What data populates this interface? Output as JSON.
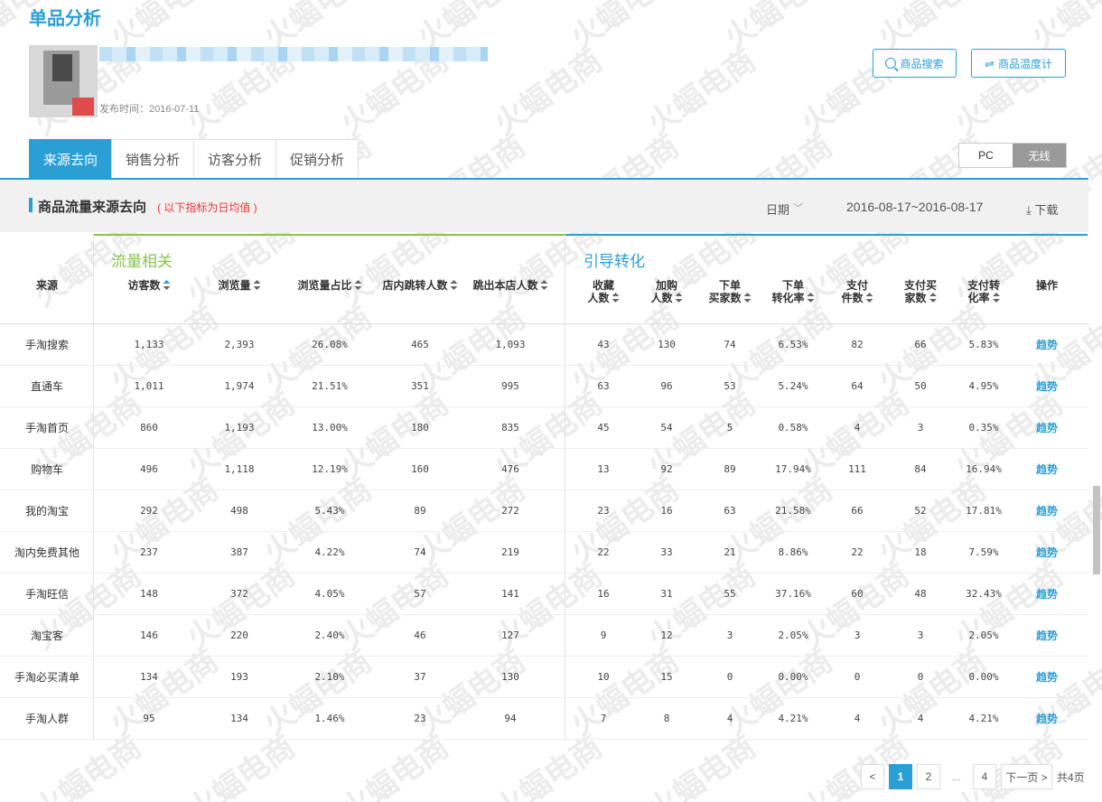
{
  "page": {
    "title": "单品分析",
    "publish_time": "发布时间：2016-07-11",
    "search_button": "商品搜索",
    "thermometer_button": "商品温度计"
  },
  "tabs": [
    "来源去向",
    "销售分析",
    "访客分析",
    "促销分析"
  ],
  "device_toggle": {
    "pc": "PC",
    "wireless": "无线",
    "selected": "无线"
  },
  "section": {
    "title": "商品流量来源去向",
    "note": "( 以下指标为日均值 )",
    "date_label": "日期",
    "date_range": "2016-08-17~2016-08-17",
    "download": "下载"
  },
  "groups": {
    "traffic": "流量相关",
    "conversion": "引导转化"
  },
  "columns": [
    {
      "label": "来源",
      "sortable": false
    },
    {
      "label": "访客数",
      "sortable": true
    },
    {
      "label": "浏览量",
      "sortable": true
    },
    {
      "label": "浏览量占比",
      "sortable": true
    },
    {
      "label": "店内跳转人数",
      "sortable": true
    },
    {
      "label": "跳出本店人数",
      "sortable": true
    },
    {
      "label": "收藏人数",
      "sortable": true
    },
    {
      "label": "加购人数",
      "sortable": true
    },
    {
      "label": "下单买家数",
      "sortable": true
    },
    {
      "label": "下单转化率",
      "sortable": true
    },
    {
      "label": "支付件数",
      "sortable": true
    },
    {
      "label": "支付买家数",
      "sortable": true
    },
    {
      "label": "支付转化率",
      "sortable": true
    },
    {
      "label": "操作",
      "sortable": false
    }
  ],
  "rows": [
    [
      "手淘搜索",
      "1,133",
      "2,393",
      "26.08%",
      "465",
      "1,093",
      "43",
      "130",
      "74",
      "6.53%",
      "82",
      "66",
      "5.83%",
      "趋势"
    ],
    [
      "直通车",
      "1,011",
      "1,974",
      "21.51%",
      "351",
      "995",
      "63",
      "96",
      "53",
      "5.24%",
      "64",
      "50",
      "4.95%",
      "趋势"
    ],
    [
      "手淘首页",
      "860",
      "1,193",
      "13.00%",
      "180",
      "835",
      "45",
      "54",
      "5",
      "0.58%",
      "4",
      "3",
      "0.35%",
      "趋势"
    ],
    [
      "购物车",
      "496",
      "1,118",
      "12.19%",
      "160",
      "476",
      "13",
      "92",
      "89",
      "17.94%",
      "111",
      "84",
      "16.94%",
      "趋势"
    ],
    [
      "我的淘宝",
      "292",
      "498",
      "5.43%",
      "89",
      "272",
      "23",
      "16",
      "63",
      "21.58%",
      "66",
      "52",
      "17.81%",
      "趋势"
    ],
    [
      "淘内免费其他",
      "237",
      "387",
      "4.22%",
      "74",
      "219",
      "22",
      "33",
      "21",
      "8.86%",
      "22",
      "18",
      "7.59%",
      "趋势"
    ],
    [
      "手淘旺信",
      "148",
      "372",
      "4.05%",
      "57",
      "141",
      "16",
      "31",
      "55",
      "37.16%",
      "60",
      "48",
      "32.43%",
      "趋势"
    ],
    [
      "淘宝客",
      "146",
      "220",
      "2.40%",
      "46",
      "127",
      "9",
      "12",
      "3",
      "2.05%",
      "3",
      "3",
      "2.05%",
      "趋势"
    ],
    [
      "手淘必买清单",
      "134",
      "193",
      "2.10%",
      "37",
      "130",
      "10",
      "15",
      "0",
      "0.00%",
      "0",
      "0",
      "0.00%",
      "趋势"
    ],
    [
      "手淘人群",
      "95",
      "134",
      "1.46%",
      "23",
      "94",
      "7",
      "8",
      "4",
      "4.21%",
      "4",
      "4",
      "4.21%",
      "趋势"
    ]
  ],
  "pagination": {
    "prev": "<",
    "pages": [
      "1",
      "2",
      "...",
      "4"
    ],
    "current": "1",
    "next": "下一页 >",
    "total": "共4页"
  },
  "watermark": "火蝠电商",
  "colors": {
    "accent": "#2a9fd6",
    "traffic_group": "#8bc34a",
    "note_red": "#e33333"
  }
}
